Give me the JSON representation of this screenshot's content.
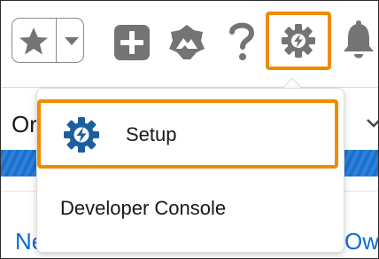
{
  "header": {
    "icons": {
      "favorites": "star-icon",
      "favorites_menu": "chevron-down-icon",
      "global_actions": "plus-icon",
      "trailhead": "trailhead-icon",
      "help": "question-icon",
      "setup": "gear-bolt-icon",
      "notifications": "bell-icon"
    }
  },
  "background_page": {
    "tab_text_fragment": "Or",
    "link_left_fragment": "Ne",
    "link_right_fragment": "Ow"
  },
  "setup_menu": {
    "items": [
      {
        "label": "Setup",
        "icon": "gear-bolt-icon",
        "highlighted": true
      },
      {
        "label": "Developer Console"
      }
    ]
  },
  "colors": {
    "highlight": "#f28b00",
    "icon_gray": "#747474",
    "setup_icon_blue": "#1b5f9e",
    "link_blue": "#0b6bd3",
    "band_blue": "#1f6fc6"
  }
}
